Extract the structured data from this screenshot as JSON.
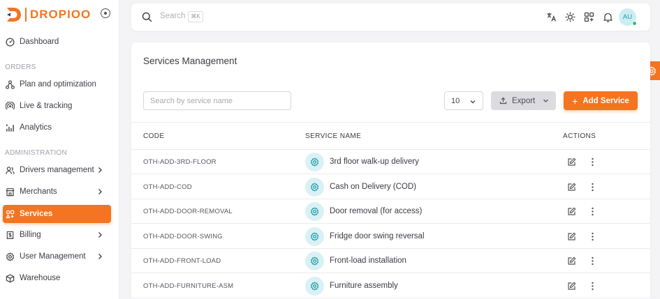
{
  "brand": {
    "name": "DROPIOO",
    "accent": "#f47421"
  },
  "sidebar": {
    "sections": {
      "orders": "ORDERS",
      "administration": "ADMINISTRATION"
    },
    "items": [
      {
        "label": "Dashboard",
        "icon": "dashboard-icon"
      },
      {
        "label": "Plan and optimization",
        "icon": "route-icon"
      },
      {
        "label": "Live & tracking",
        "icon": "tracking-icon"
      },
      {
        "label": "Analytics",
        "icon": "analytics-icon"
      },
      {
        "label": "Drivers management",
        "icon": "users-icon",
        "expandable": true
      },
      {
        "label": "Merchants",
        "icon": "store-icon",
        "expandable": true
      },
      {
        "label": "Services",
        "icon": "services-icon",
        "active": true
      },
      {
        "label": "Billing",
        "icon": "billing-icon",
        "expandable": true
      },
      {
        "label": "User Management",
        "icon": "gear-icon",
        "expandable": true
      },
      {
        "label": "Warehouse",
        "icon": "box-icon"
      }
    ]
  },
  "topbar": {
    "search_placeholder": "Search",
    "shortcut": "⌘K",
    "avatar_initials": "AU"
  },
  "main": {
    "title": "Services Management",
    "filter_placeholder": "Search by service name",
    "page_size": "10",
    "export_label": "Export",
    "add_label": "Add Service",
    "columns": {
      "code": "CODE",
      "service_name": "SERVICE NAME",
      "actions": "ACTIONS"
    },
    "rows": [
      {
        "code": "OTH-ADD-3RD-FLOOR",
        "name": "3rd floor walk-up delivery"
      },
      {
        "code": "OTH-ADD-COD",
        "name": "Cash on Delivery (COD)"
      },
      {
        "code": "OTH-ADD-DOOR-REMOVAL",
        "name": "Door removal (for access)"
      },
      {
        "code": "OTH-ADD-DOOR-SWING",
        "name": "Fridge door swing reversal"
      },
      {
        "code": "OTH-ADD-FRONT-LOAD",
        "name": "Front-load installation"
      },
      {
        "code": "OTH-ADD-FURNITURE-ASM",
        "name": "Furniture assembly"
      }
    ]
  }
}
